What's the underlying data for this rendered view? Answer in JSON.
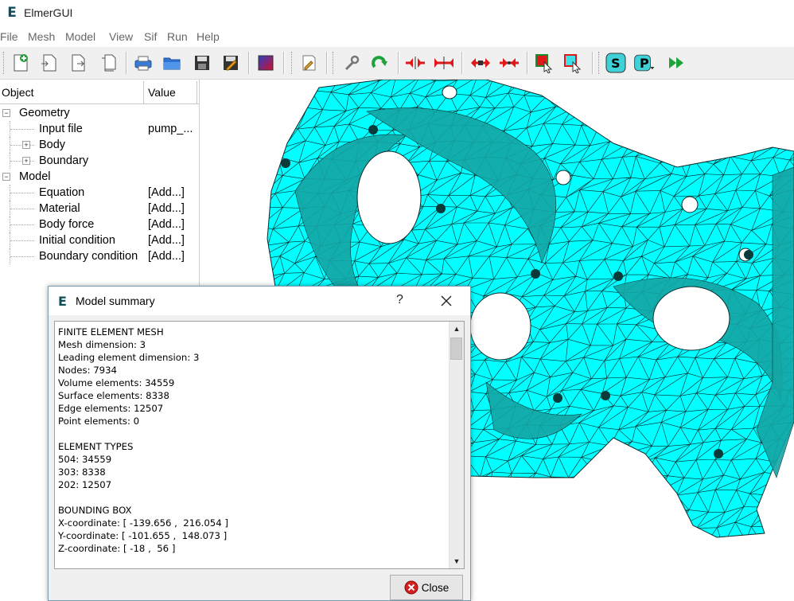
{
  "app": {
    "title": "ElmerGUI",
    "logo_letter": "E"
  },
  "menu": [
    "File",
    "Mesh",
    "Model",
    "View",
    "Sif",
    "Run",
    "Help"
  ],
  "toolbar": {
    "icons": [
      "new-project-icon",
      "open-icon",
      "save-as-icon",
      "copy-icon",
      "print-icon",
      "open-folder-icon",
      "save-icon",
      "save-edit-icon",
      "palette-icon",
      "edit-sif-icon",
      "settings-wrench-icon",
      "redo-icon",
      "unify-icon",
      "divide-icon",
      "expand-icon",
      "collapse-icon",
      "select-red-icon",
      "select-cyan-icon"
    ],
    "solver_label": "S",
    "post_label": "P",
    "run_icon": "run-fast-forward-icon"
  },
  "tree": {
    "header_object": "Object",
    "header_value": "Value",
    "rows": [
      {
        "label": "Geometry",
        "value": "",
        "level": 0,
        "expander": "-"
      },
      {
        "label": "Input file",
        "value": "pump_...",
        "level": 1,
        "expander": ""
      },
      {
        "label": "Body",
        "value": "",
        "level": 1,
        "expander": "+"
      },
      {
        "label": "Boundary",
        "value": "",
        "level": 1,
        "expander": "+"
      },
      {
        "label": "Model",
        "value": "",
        "level": 0,
        "expander": "-"
      },
      {
        "label": "Equation",
        "value": "[Add...]",
        "level": 1,
        "expander": ""
      },
      {
        "label": "Material",
        "value": "[Add...]",
        "level": 1,
        "expander": ""
      },
      {
        "label": "Body force",
        "value": "[Add...]",
        "level": 1,
        "expander": ""
      },
      {
        "label": "Initial condition",
        "value": "[Add...]",
        "level": 1,
        "expander": ""
      },
      {
        "label": "Boundary condition",
        "value": "[Add...]",
        "level": 1,
        "expander": ""
      }
    ]
  },
  "mesh": {
    "fill_color": "#00ffff",
    "line_color": "#0a2a2a",
    "shade_color": "#15a5a5"
  },
  "dialog": {
    "logo_letter": "E",
    "title": "Model summary",
    "help": "?",
    "summary_lines": [
      "FINITE ELEMENT MESH",
      "Mesh dimension: 3",
      "Leading element dimension: 3",
      "Nodes: 7934",
      "Volume elements: 34559",
      "Surface elements: 8338",
      "Edge elements: 12507",
      "Point elements: 0",
      "",
      "ELEMENT TYPES",
      "504: 34559",
      "303: 8338",
      "202: 12507",
      "",
      "BOUNDING BOX",
      "X-coordinate: [ -139.656 ,  216.054 ]",
      "Y-coordinate: [ -101.655 ,  148.073 ]",
      "Z-coordinate: [ -18 ,  56 ]"
    ],
    "close_label": "Close"
  }
}
